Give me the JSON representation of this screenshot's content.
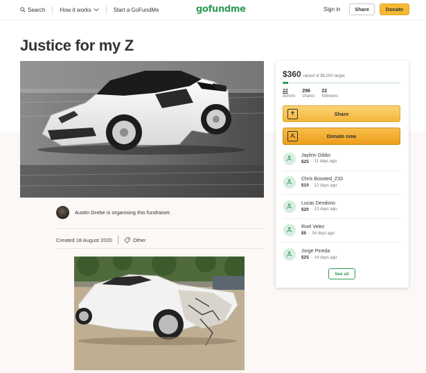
{
  "header": {
    "search_label": "Search",
    "how_it_works_label": "How it works",
    "start_label": "Start a GoFundMe",
    "logo_text": "gofundme",
    "signin_label": "Sign in",
    "share_label": "Share",
    "donate_label": "Donate"
  },
  "campaign": {
    "title": "Justice for my Z",
    "organiser_text": "Austin Grebe is organising this fundraiser.",
    "created_text": "Created 18 August 2020",
    "category": "Other"
  },
  "sidebar": {
    "raised": "$360",
    "goal_text": "raised of $8,000 target",
    "progress_fraction": 0.045,
    "stats": [
      {
        "value": "22",
        "label": "donors"
      },
      {
        "value": "296",
        "label": "shares"
      },
      {
        "value": "22",
        "label": "followers"
      }
    ],
    "share_button": "Share",
    "donate_button": "Donate now",
    "donations": [
      {
        "name": "Jaylinn Gibbs",
        "amount": "$25",
        "time": "11 days ago"
      },
      {
        "name": "Chris Boosted_Z33",
        "amount": "$10",
        "time": "12 days ago"
      },
      {
        "name": "Lucas Deodono",
        "amount": "$20",
        "time": "13 days ago"
      },
      {
        "name": "Roel Velez",
        "amount": "$5",
        "time": "14 days ago"
      },
      {
        "name": "Jorge Pineda",
        "amount": "$25",
        "time": "14 days ago"
      }
    ],
    "see_all_label": "See all"
  },
  "colors": {
    "brand_green": "#2e9a53",
    "donate_yellow": "#f5b935"
  }
}
